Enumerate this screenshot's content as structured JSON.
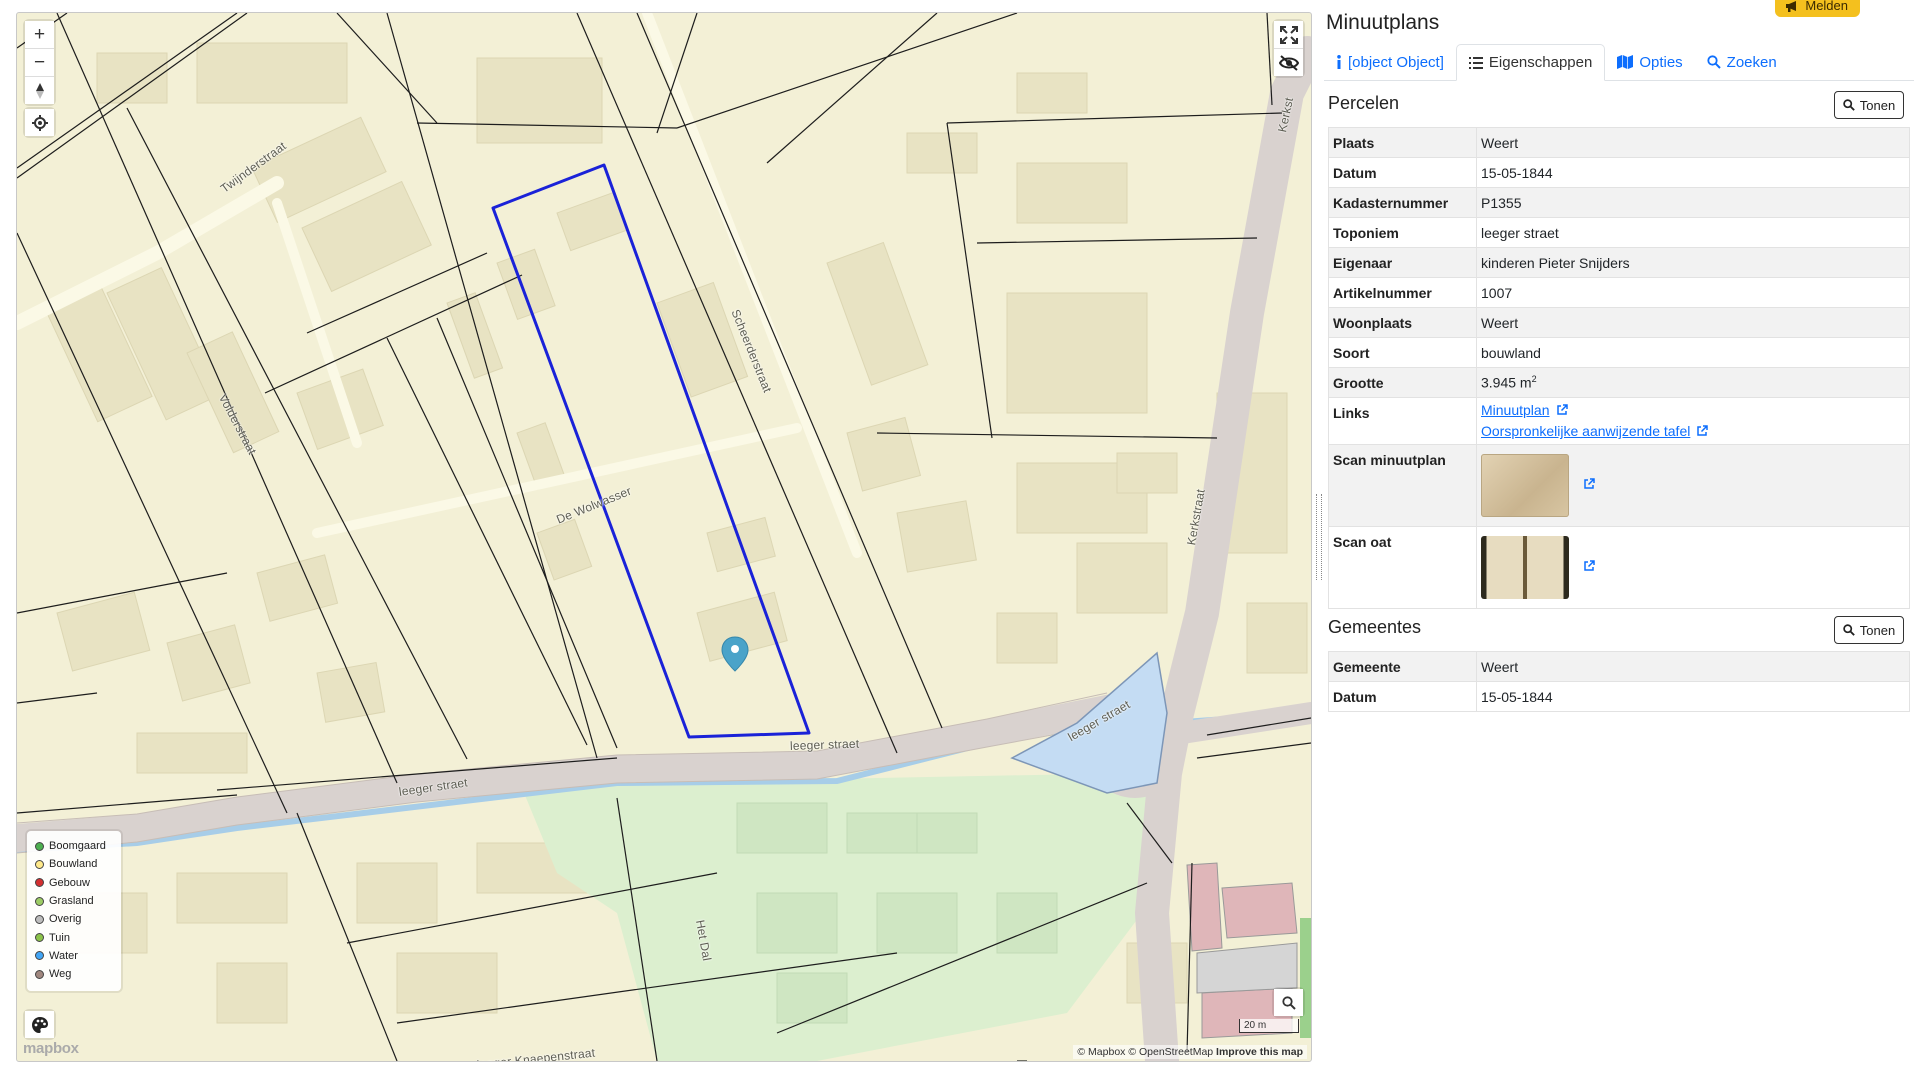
{
  "map": {
    "street_labels": [
      {
        "text": "Twijnderstraat"
      },
      {
        "text": "Volderstraat"
      },
      {
        "text": "De Wolwasser"
      },
      {
        "text": "Scheerderstraat"
      },
      {
        "text": "Kerkstraat"
      },
      {
        "text": "Kerkst"
      },
      {
        "text": "leeger straet"
      },
      {
        "text": "leeger straet"
      },
      {
        "text": "leeger straet"
      },
      {
        "text": "Het Dal"
      },
      {
        "text": "leeger Knaepenstraat"
      }
    ],
    "controls": {
      "zoom_in": "+",
      "zoom_out": "−"
    },
    "legend": [
      {
        "label": "Boomgaard",
        "color": "#4caf50"
      },
      {
        "label": "Bouwland",
        "color": "#ffe98a"
      },
      {
        "label": "Gebouw",
        "color": "#d32f2f"
      },
      {
        "label": "Grasland",
        "color": "#9ccc65"
      },
      {
        "label": "Overig",
        "color": "#bdbdbd"
      },
      {
        "label": "Tuin",
        "color": "#8bc34a"
      },
      {
        "label": "Water",
        "color": "#42a5f5"
      },
      {
        "label": "Weg",
        "color": "#a1887f"
      }
    ],
    "scale": "20 m",
    "attribution": {
      "mapbox": "© Mapbox",
      "osm": "© OpenStreetMap",
      "improve": "Improve this map"
    },
    "logo": "mapbox",
    "parcel_color": "#1a22d8",
    "marker_color": "#4aa3c9"
  },
  "panel": {
    "melden": "Melden",
    "title": "Minuutplans",
    "tabs": [
      {
        "label": "[object Object]",
        "icon": "info-icon"
      },
      {
        "label": "Eigenschappen",
        "icon": "list-icon"
      },
      {
        "label": "Opties",
        "icon": "map-icon"
      },
      {
        "label": "Zoeken",
        "icon": "search-icon"
      }
    ],
    "percelen": {
      "title": "Percelen",
      "button": "Tonen",
      "rows": [
        {
          "key": "Plaats",
          "value": "Weert"
        },
        {
          "key": "Datum",
          "value": "15-05-1844"
        },
        {
          "key": "Kadasternummer",
          "value": "P1355"
        },
        {
          "key": "Toponiem",
          "value": "leeger straet"
        },
        {
          "key": "Eigenaar",
          "value": "kinderen Pieter Snijders"
        },
        {
          "key": "Artikelnummer",
          "value": "1007"
        },
        {
          "key": "Woonplaats",
          "value": "Weert"
        },
        {
          "key": "Soort",
          "value": "bouwland"
        }
      ],
      "grootte_key": "Grootte",
      "grootte_value": "3.945 m",
      "grootte_unit_sup": "2",
      "links_key": "Links",
      "link1": "Minuutplan",
      "link2": "Oorspronkelijke aanwijzende tafel",
      "scan1_key": "Scan minuutplan",
      "scan2_key": "Scan oat"
    },
    "gemeentes": {
      "title": "Gemeentes",
      "button": "Tonen",
      "rows": [
        {
          "key": "Gemeente",
          "value": "Weert"
        },
        {
          "key": "Datum",
          "value": "15-05-1844"
        }
      ]
    },
    "link_color": "#0d6efd",
    "accent_color": "#f4c01e"
  }
}
